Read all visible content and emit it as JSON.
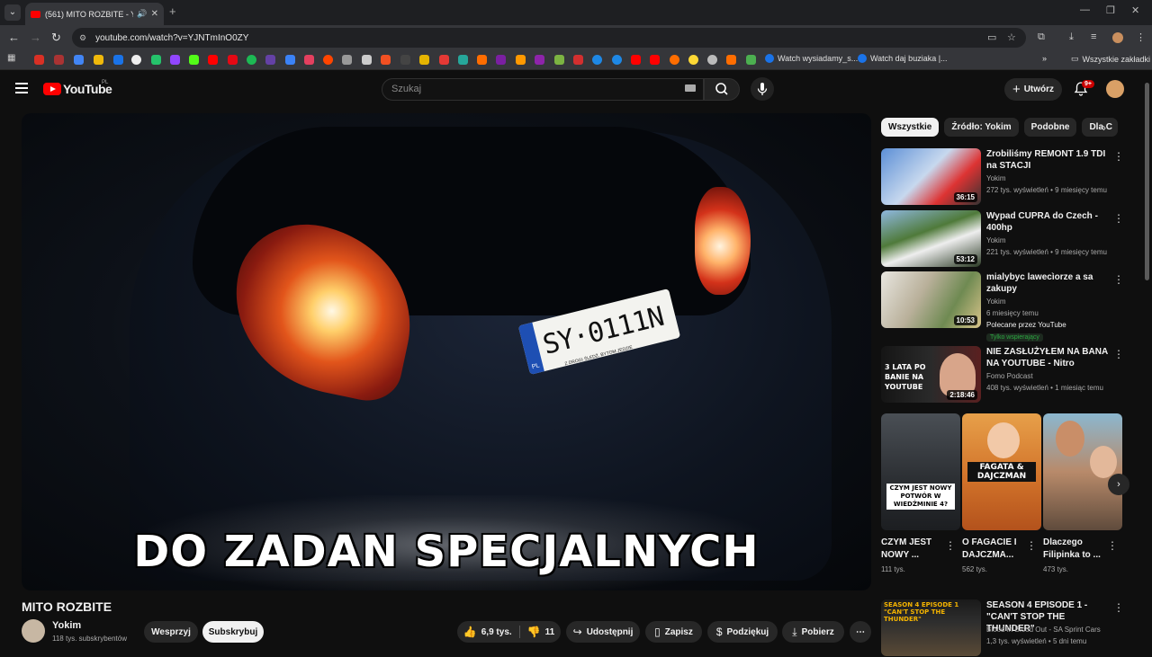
{
  "browser": {
    "tab_title": "(561) MITO ROZBITE - YouTube",
    "url": "youtube.com/watch?v=YJNTmInO0ZY",
    "bookmarks": [
      {
        "label": "Watch wysiadamy_s..."
      },
      {
        "label": "Watch daj buziaka |..."
      }
    ],
    "all_bookmarks": "Wszystkie zakładki"
  },
  "header": {
    "logo": "YouTube",
    "region": "PL",
    "search_placeholder": "Szukaj",
    "create_label": "Utwórz",
    "notifications": "9+"
  },
  "video": {
    "overlay_text": "DO ZADAN SPECJALNYCH",
    "plate_text": "SY·0111N",
    "plate_country": "PL",
    "plate_slogan": "Z DROGI ŚLEDŹ, BYTOM JEDZIE",
    "title": "MITO ROZBITE",
    "channel": "Yokim",
    "subscribers": "118 tys. subskrybentów",
    "join_label": "Wesprzyj",
    "subscribe_label": "Subskrybuj",
    "likes": "6,9 tys.",
    "dislikes": "11",
    "share_label": "Udostępnij",
    "save_label": "Zapisz",
    "thanks_label": "Podziękuj",
    "download_label": "Pobierz"
  },
  "sidebar": {
    "chips": [
      "Wszystkie",
      "Źródło: Yokim",
      "Podobne",
      "Dla C"
    ],
    "recommendations": [
      {
        "title": "Zrobiliśmy REMONT 1.9 TDI na STACJI",
        "channel": "Yokim",
        "meta": "272 tys. wyświetleń • 9 miesięcy temu",
        "duration": "36:15"
      },
      {
        "title": "Wypad CUPRA do Czech - 400hp",
        "channel": "Yokim",
        "meta": "221 tys. wyświetleń • 9 miesięcy temu",
        "duration": "53:12"
      },
      {
        "title": "mialybyc lawecìorze a sa zakupy",
        "channel": "Yokim",
        "meta": "6 miesięcy temu",
        "extra": "Polecane przez YouTube",
        "badge": "Tylko wspierający",
        "duration": "10:53"
      },
      {
        "title": "NIE ZASŁUŻYŁEM NA BANA NA YOUTUBE - Nitro",
        "channel": "Fomo Podcast",
        "meta": "408 tys. wyświetleń • 1 miesiąc temu",
        "duration": "2:18:46",
        "thumb_text": "3 LATA PO BANIE NA YOUTUBE"
      },
      {
        "title": "SEASON 4 EPISODE 1 - \"CAN'T STOP THE THUNDER\"",
        "channel": "Blood In Blood Out - SA Sprint Cars",
        "meta": "1,3 tys. wyświetleń • 5 dni temu",
        "thumb_text": "SEASON 4 EPISODE 1 \"CAN'T STOP THE THUNDER\""
      }
    ],
    "shorts": [
      {
        "title": "CZYM JEST NOWY ...",
        "views": "111 tys.",
        "thumb_text": "CZYM JEST NOWY POTWÓR W WIEDŹMINIE 4?"
      },
      {
        "title": "O FAGACIE I DAJCZMA...",
        "views": "562 tys.",
        "thumb_text": "FAGATA & DAJCZMAN"
      },
      {
        "title": "Dlaczego Filipinka to ...",
        "views": "473 tys.",
        "thumb_text": ""
      }
    ]
  }
}
